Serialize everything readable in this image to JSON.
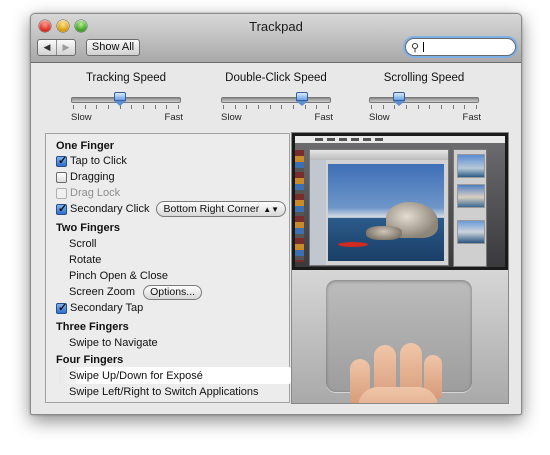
{
  "window": {
    "title": "Trackpad"
  },
  "toolbar": {
    "back_icon": "◀",
    "forward_icon": "▶",
    "show_all_label": "Show All",
    "search_value": "",
    "search_icon": "magnifier-icon"
  },
  "sliders": [
    {
      "title": "Tracking Speed",
      "low_label": "Slow",
      "high_label": "Fast",
      "level": 0.45
    },
    {
      "title": "Double-Click Speed",
      "low_label": "Slow",
      "high_label": "Fast",
      "level": 0.78
    },
    {
      "title": "Scrolling Speed",
      "low_label": "Slow",
      "high_label": "Fast",
      "level": 0.25
    }
  ],
  "gestures": {
    "one_finger": {
      "header": "One Finger",
      "tap_to_click": {
        "label": "Tap to Click",
        "checked": true
      },
      "dragging": {
        "label": "Dragging",
        "checked": false
      },
      "drag_lock": {
        "label": "Drag Lock",
        "checked": false,
        "enabled": false
      },
      "secondary_click": {
        "label": "Secondary Click",
        "checked": true,
        "option": "Bottom Right Corner"
      }
    },
    "two_fingers": {
      "header": "Two Fingers",
      "scroll": "Scroll",
      "rotate": "Rotate",
      "pinch": "Pinch Open & Close",
      "screen_zoom": {
        "label": "Screen Zoom",
        "button": "Options..."
      },
      "secondary_tap": {
        "label": "Secondary Tap",
        "checked": true
      }
    },
    "three_fingers": {
      "header": "Three Fingers",
      "swipe": "Swipe to Navigate"
    },
    "four_fingers": {
      "header": "Four Fingers",
      "swipe_updown": "Swipe Up/Down for Exposé",
      "swipe_leftright": "Swipe Left/Right to Switch Applications",
      "selected": "swipe_updown"
    }
  }
}
